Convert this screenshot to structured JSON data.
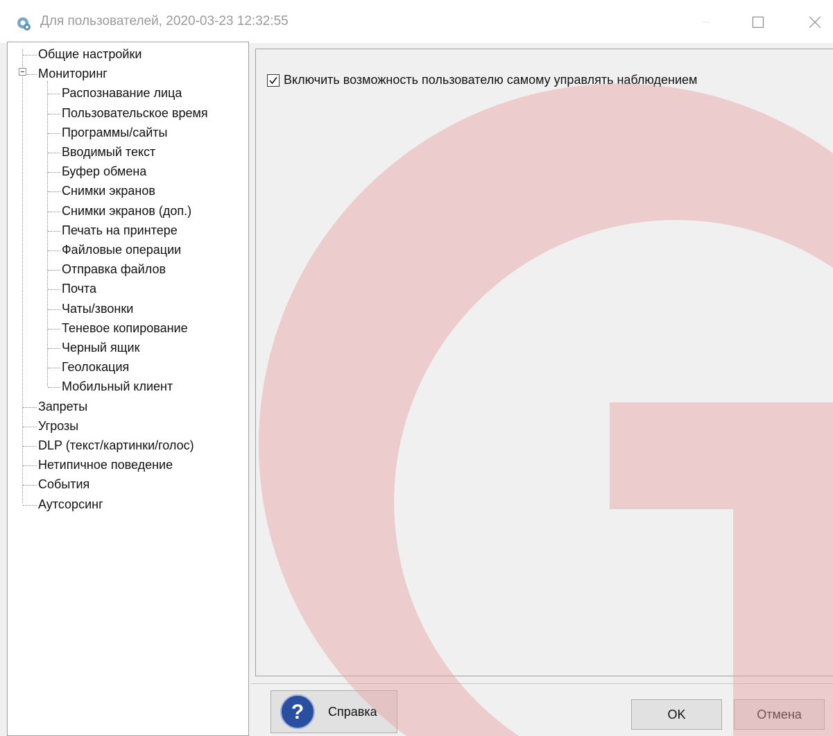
{
  "window": {
    "title": "Для пользователей, 2020-03-23 12:32:55"
  },
  "tree": {
    "items": [
      {
        "label": "Общие настройки"
      },
      {
        "label": "Мониторинг"
      },
      {
        "label": "Распознавание лица"
      },
      {
        "label": "Пользовательское время"
      },
      {
        "label": "Программы/сайты"
      },
      {
        "label": "Вводимый текст"
      },
      {
        "label": "Буфер обмена"
      },
      {
        "label": "Снимки экранов"
      },
      {
        "label": "Снимки экранов (доп.)"
      },
      {
        "label": "Печать на принтере"
      },
      {
        "label": "Файловые операции"
      },
      {
        "label": "Отправка файлов"
      },
      {
        "label": "Почта"
      },
      {
        "label": "Чаты/звонки"
      },
      {
        "label": "Теневое копирование"
      },
      {
        "label": "Черный ящик"
      },
      {
        "label": "Геолокация"
      },
      {
        "label": "Мобильный клиент"
      },
      {
        "label": "Запреты"
      },
      {
        "label": "Угрозы"
      },
      {
        "label": "DLP (текст/картинки/голос)"
      },
      {
        "label": "Нетипичное поведение"
      },
      {
        "label": "События"
      },
      {
        "label": "Аутсорсинг"
      }
    ]
  },
  "content": {
    "checkbox_label": "Включить возможность пользователю самому управлять наблюдением",
    "checkbox_checked": true
  },
  "buttons": {
    "help_label": "Справка",
    "ok_label": "OK",
    "cancel_label": "Отмена"
  },
  "colors": {
    "watermark": "#f3c7c7",
    "help_icon": "#2b4fa0"
  }
}
